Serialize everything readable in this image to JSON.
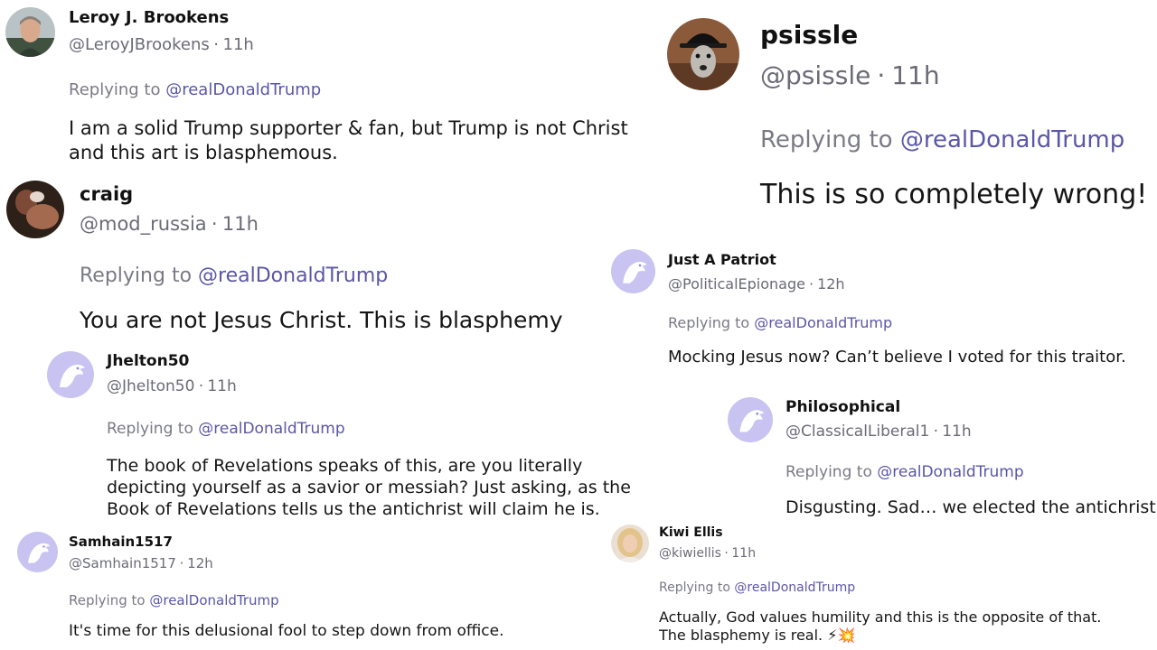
{
  "colors": {
    "mention": "#5a56a8",
    "meta": "#6b6b78",
    "default_avatar_bg": "#c9c3f2",
    "default_avatar_fg": "#ffffff"
  },
  "reply_prefix": "Replying to",
  "separator": "·",
  "posts": [
    {
      "name": "Leroy J. Brookens",
      "handle": "@LeroyJBrookens",
      "time": "11h",
      "replying_to": "@realDonaldTrump",
      "text": "I am a solid Trump supporter & fan, but Trump is not Christ and this art is blasphemous.",
      "avatar": "photo-man-icon"
    },
    {
      "name": "craig",
      "handle": "@mod_russia",
      "time": "11h",
      "replying_to": "@realDonaldTrump",
      "text": "You are not Jesus Christ. This is blasphemy",
      "avatar": "photo-icon"
    },
    {
      "name": "Jhelton50",
      "handle": "@Jhelton50",
      "time": "11h",
      "replying_to": "@realDonaldTrump",
      "text": "The book of Revelations speaks of this, are you literally depicting yourself as a savior or messiah? Just asking, as the Book of Revelations tells us the antichrist will claim he is.",
      "avatar": "eagle-icon"
    },
    {
      "name": "Samhain1517",
      "handle": "@Samhain1517",
      "time": "12h",
      "replying_to": "@realDonaldTrump",
      "text": "It's time for this delusional fool to step down from office.",
      "avatar": "eagle-icon"
    },
    {
      "name": "psissle",
      "handle": "@psissle",
      "time": "11h",
      "replying_to": "@realDonaldTrump",
      "text": "This is so completely wrong!",
      "avatar": "photo-dog-icon"
    },
    {
      "name": "Just A Patriot",
      "handle": "@PoliticalEpionage",
      "time": "12h",
      "replying_to": "@realDonaldTrump",
      "text": "Mocking Jesus now? Can’t believe I voted for this traitor.",
      "avatar": "eagle-icon"
    },
    {
      "name": "Philosophical",
      "handle": "@ClassicalLiberal1",
      "time": "11h",
      "replying_to": "@realDonaldTrump",
      "text": "Disgusting. Sad… we elected the antichrist",
      "avatar": "eagle-icon"
    },
    {
      "name": "Kiwi Ellis",
      "handle": "@kiwiellis",
      "time": "11h",
      "replying_to": "@realDonaldTrump",
      "text": "Actually, God values humility and this is the opposite of that. The blasphemy is real. ⚡💥",
      "avatar": "photo-woman-icon"
    }
  ]
}
